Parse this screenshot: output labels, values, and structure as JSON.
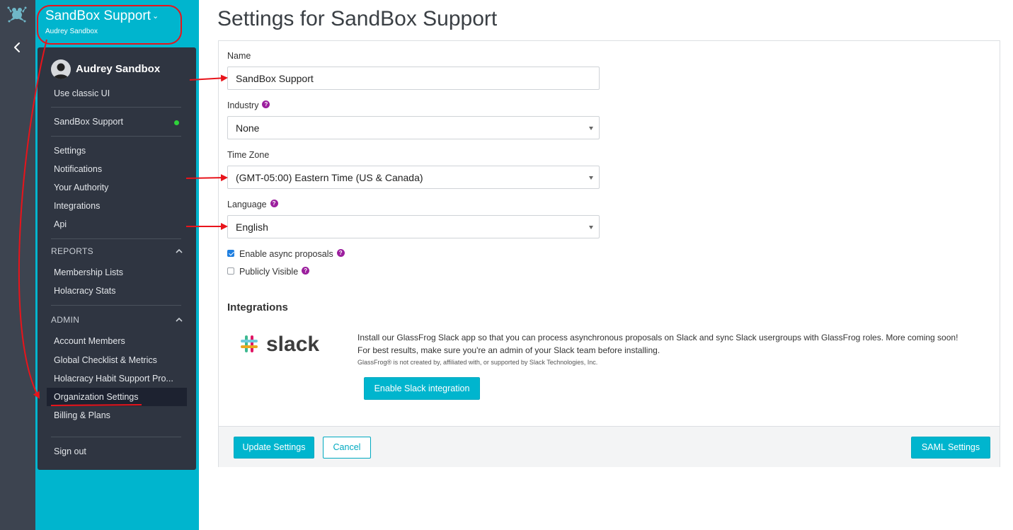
{
  "org_header": {
    "org_name": "SandBox Support",
    "user_name": "Audrey Sandbox"
  },
  "menu": {
    "user_name": "Audrey Sandbox",
    "classic_ui": "Use classic UI",
    "org_item": "SandBox Support",
    "org_status_color": "#2ed33a",
    "items": [
      {
        "label": "Settings"
      },
      {
        "label": "Notifications"
      },
      {
        "label": "Your Authority"
      },
      {
        "label": "Integrations"
      },
      {
        "label": "Api"
      }
    ],
    "reports": {
      "title": "REPORTS",
      "items": [
        {
          "label": "Membership Lists"
        },
        {
          "label": "Holacracy Stats"
        }
      ]
    },
    "admin": {
      "title": "ADMIN",
      "items": [
        {
          "label": "Account Members"
        },
        {
          "label": "Global Checklist & Metrics"
        },
        {
          "label": "Holacracy Habit Support Pro..."
        },
        {
          "label": "Organization Settings"
        },
        {
          "label": "Billing & Plans"
        }
      ]
    },
    "sign_out": "Sign out"
  },
  "page": {
    "title": "Settings for SandBox Support"
  },
  "form": {
    "name_label": "Name",
    "name_value": "SandBox Support",
    "industry_label": "Industry",
    "industry_value": "None",
    "timezone_label": "Time Zone",
    "timezone_value": "(GMT-05:00) Eastern Time (US & Canada)",
    "language_label": "Language",
    "language_value": "English",
    "async_label": "Enable async proposals",
    "async_checked": true,
    "public_label": "Publicly Visible",
    "public_checked": false,
    "help_glyph": "?"
  },
  "integrations": {
    "title": "Integrations",
    "slack_wordmark": "slack",
    "desc_line1": "Install our GlassFrog Slack app so that you can process asynchronous proposals on Slack and sync Slack usergroups with GlassFrog roles. More coming soon!",
    "desc_line2": "For best results, make sure you're an admin of your Slack team before installing.",
    "note": "GlassFrog® is not created by, affiliated with, or supported by Slack Technologies, Inc.",
    "enable_button": "Enable Slack integration"
  },
  "footer": {
    "update_button": "Update Settings",
    "cancel_button": "Cancel",
    "saml_button": "SAML Settings"
  },
  "colors": {
    "accent": "#00b5ce",
    "sidebar": "#2f3541",
    "rail": "#3d4450",
    "help_badge": "#9c1f9e",
    "annotation": "#e8141b"
  },
  "icons": {
    "logo": "glassfrog-logo-icon",
    "back": "chevron-left-icon",
    "org_dropdown": "chevron-down-icon",
    "section_toggle": "chevron-up-icon",
    "select_arrow": "caret-down-icon",
    "help": "question-circle-icon"
  }
}
